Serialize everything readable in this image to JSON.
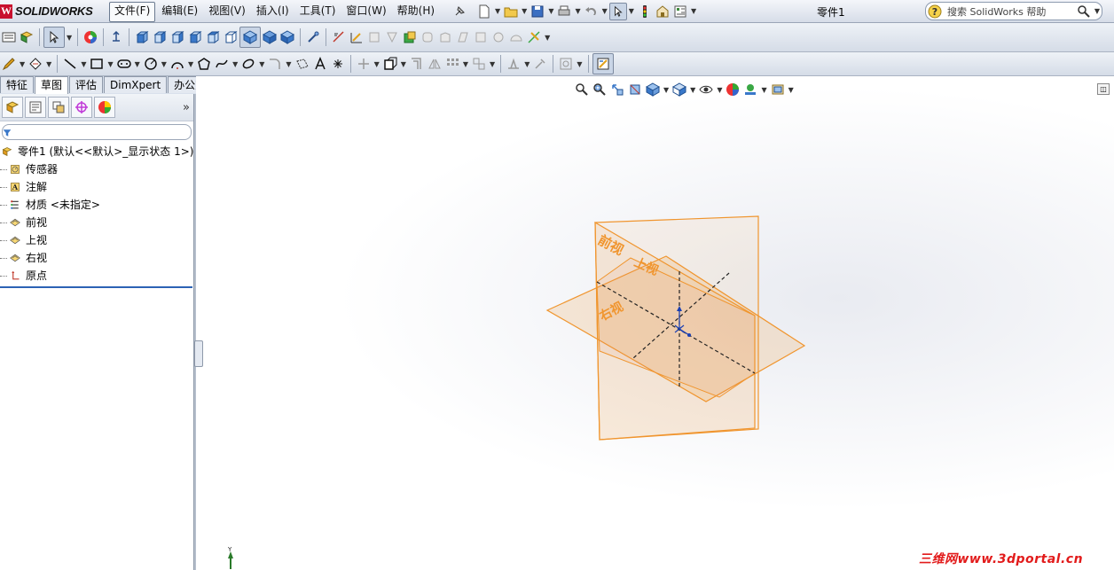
{
  "app": {
    "logo_text": "SOLIDWORKS",
    "logo_letter": "W",
    "document_title": "零件1"
  },
  "menu": [
    {
      "label": "文件(F)",
      "active": true
    },
    {
      "label": "编辑(E)"
    },
    {
      "label": "视图(V)"
    },
    {
      "label": "插入(I)"
    },
    {
      "label": "工具(T)"
    },
    {
      "label": "窗口(W)"
    },
    {
      "label": "帮助(H)"
    }
  ],
  "search": {
    "placeholder": "搜索 SolidWorks 帮助"
  },
  "tabs": [
    {
      "label": "特征"
    },
    {
      "label": "草图",
      "active": true
    },
    {
      "label": "评估"
    },
    {
      "label": "DimXpert"
    },
    {
      "label": "办公室产品"
    }
  ],
  "tree": {
    "root": "零件1  (默认<<默认>_显示状态 1>)",
    "items": [
      {
        "label": "传感器",
        "icon": "sensor-icon"
      },
      {
        "label": "注解",
        "icon": "annotation-icon"
      },
      {
        "label": "材质 <未指定>",
        "icon": "material-icon"
      },
      {
        "label": "前视",
        "icon": "plane-icon"
      },
      {
        "label": "上视",
        "icon": "plane-icon"
      },
      {
        "label": "右视",
        "icon": "plane-icon"
      },
      {
        "label": "原点",
        "icon": "origin-icon"
      }
    ]
  },
  "planes": {
    "front_label": "前视",
    "top_label": "上视",
    "right_label": "右视",
    "color": "#f0952e"
  },
  "triad": {
    "axis_label": "Y"
  },
  "watermark": "三维网www.3dportal.cn",
  "colors": {
    "accent": "#2c63b5",
    "brand": "#c8102e",
    "watermark": "#e21b1b"
  }
}
